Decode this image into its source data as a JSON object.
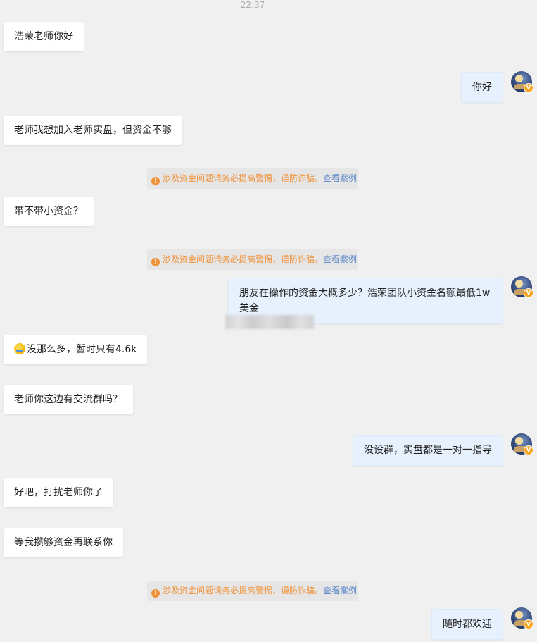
{
  "timestamp": "22:37",
  "messages": [
    {
      "text": "浩荣老师你好"
    },
    {
      "text": "你好"
    },
    {
      "text": "老师我想加入老师实盘，但资金不够"
    },
    {
      "text": "带不带小资金？"
    },
    {
      "text": "朋友在操作的资金大概多少？浩荣团队小资金名额最低1w美金"
    },
    {
      "text": "没那么多，暂时只有4.6k",
      "emoji": "crying-laughing-emoji"
    },
    {
      "text": "老师你这边有交流群吗？"
    },
    {
      "text": "没设群，实盘都是一对一指导"
    },
    {
      "text": "好吧，打扰老师你了"
    },
    {
      "text": "等我攒够资金再联系你"
    },
    {
      "text": "随时都欢迎"
    }
  ],
  "warning": {
    "icon": "!",
    "text": "涉及资金问题请务必提高警惕，谨防诈骗。",
    "link": "查看案例"
  },
  "avatar": {
    "badge": "V"
  },
  "colors": {
    "background": "#f0f0f0",
    "incoming_bubble": "#ffffff",
    "outgoing_bubble": "#e6f1fd",
    "warning_text": "#f0923a",
    "warning_link": "#5a86c8",
    "badge": "#f5a623"
  }
}
